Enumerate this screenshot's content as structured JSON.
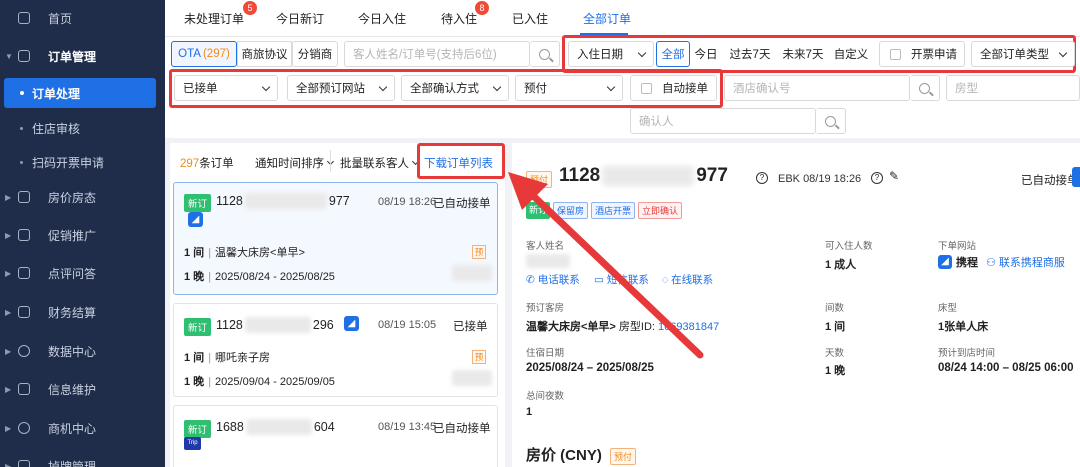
{
  "sidebar": {
    "items": [
      {
        "label": "首页",
        "icon": "home-icon"
      },
      {
        "label": "订单管理",
        "icon": "order-icon"
      },
      {
        "label": "房价房态",
        "icon": "price-icon"
      },
      {
        "label": "促销推广",
        "icon": "promo-icon"
      },
      {
        "label": "点评问答",
        "icon": "review-icon"
      },
      {
        "label": "财务结算",
        "icon": "finance-icon"
      },
      {
        "label": "数据中心",
        "icon": "data-icon"
      },
      {
        "label": "信息维护",
        "icon": "info-icon"
      },
      {
        "label": "商机中心",
        "icon": "biz-icon"
      },
      {
        "label": "掉牌管理",
        "icon": "manage-icon"
      }
    ],
    "sub": {
      "active": "订单处理",
      "items": [
        "住店审核",
        "扫码开票申请"
      ]
    }
  },
  "tabs": [
    {
      "label": "未处理订单",
      "badge": "5"
    },
    {
      "label": "今日新订"
    },
    {
      "label": "今日入住"
    },
    {
      "label": "待入住",
      "badge": "8"
    },
    {
      "label": "已入住"
    },
    {
      "label": "全部订单"
    }
  ],
  "filters": {
    "channel": {
      "ota": "OTA",
      "ota_count": "(297)",
      "b": "商旅协议",
      "c": "分销商"
    },
    "search_placeholder": "客人姓名/订单号(支持后6位)",
    "date_type": "入住日期",
    "date_opts": [
      "全部",
      "今日",
      "过去7天",
      "未来7天",
      "自定义"
    ],
    "invoice": "开票申请",
    "order_type": "全部订单类型",
    "status": "已接单",
    "site": "全部预订网站",
    "confirm": "全部确认方式",
    "pay": "预付",
    "auto": "自动接单",
    "hotel_confirm_placeholder": "酒店确认号",
    "room_placeholder": "房型",
    "confirmer_placeholder": "确认人"
  },
  "list": {
    "count": "297",
    "count_suffix": "条订单",
    "sort": "通知时间排序",
    "batch": "批量联系客人",
    "download": "下载订单列表",
    "cards": [
      {
        "tag": "新订",
        "id_a": "1128",
        "id_b": "977",
        "time": "08/19 18:26",
        "status": "已自动接单",
        "rooms": "1 间",
        "room": "温馨大床房<单早>",
        "nights": "1 晚",
        "dates": "2025/08/24 - 2025/08/25",
        "yu": "预"
      },
      {
        "tag": "新订",
        "id_a": "1128",
        "id_b": "296",
        "time": "08/19 15:05",
        "status": "已接单",
        "rooms": "1 间",
        "room": "哪吒亲子房",
        "nights": "1 晚",
        "dates": "2025/09/04 - 2025/09/05",
        "yu": "预"
      },
      {
        "tag": "新订",
        "id_a": "1688",
        "id_b": "604",
        "time": "08/19 13:45",
        "status": "已自动接单",
        "trip": "Trip"
      }
    ]
  },
  "detail": {
    "pay_tag": "预付",
    "id_a": "1128",
    "id_b": "977",
    "ebk": "EBK 08/19 18:26",
    "status": "已自动接单",
    "tags": [
      "新订",
      "保留房",
      "酒店开票",
      "立即确认"
    ],
    "guest_label": "客人姓名",
    "phone": "电话联系",
    "sms": "短信联系",
    "online": "在线联系",
    "occ_label": "可入住人数",
    "occ": "1 成人",
    "site_label": "下单网站",
    "site": "携程",
    "ctrip_contact": "联系携程商服",
    "roomtype_label": "预订客房",
    "roomtype": "温馨大床房<单早>",
    "roomtype_id": "房型ID:",
    "roomtype_id_val": "1669381847",
    "count_label": "间数",
    "count": "1 间",
    "bed_label": "床型",
    "bed": "1张单人床",
    "date_label": "住宿日期",
    "date": "2025/08/24 – 2025/08/25",
    "days_label": "天数",
    "days": "1 晚",
    "arrive_label": "预计到店时间",
    "arrive": "08/24 14:00 – 08/25 06:00",
    "total_label": "总间夜数",
    "total": "1",
    "price_title": "房价 (CNY)",
    "price_tag": "预付"
  },
  "colors": {
    "primary": "#1f6fe5",
    "sidebar": "#1f2d4a",
    "highlight": "#e8393a",
    "badge": "#f04a37"
  }
}
